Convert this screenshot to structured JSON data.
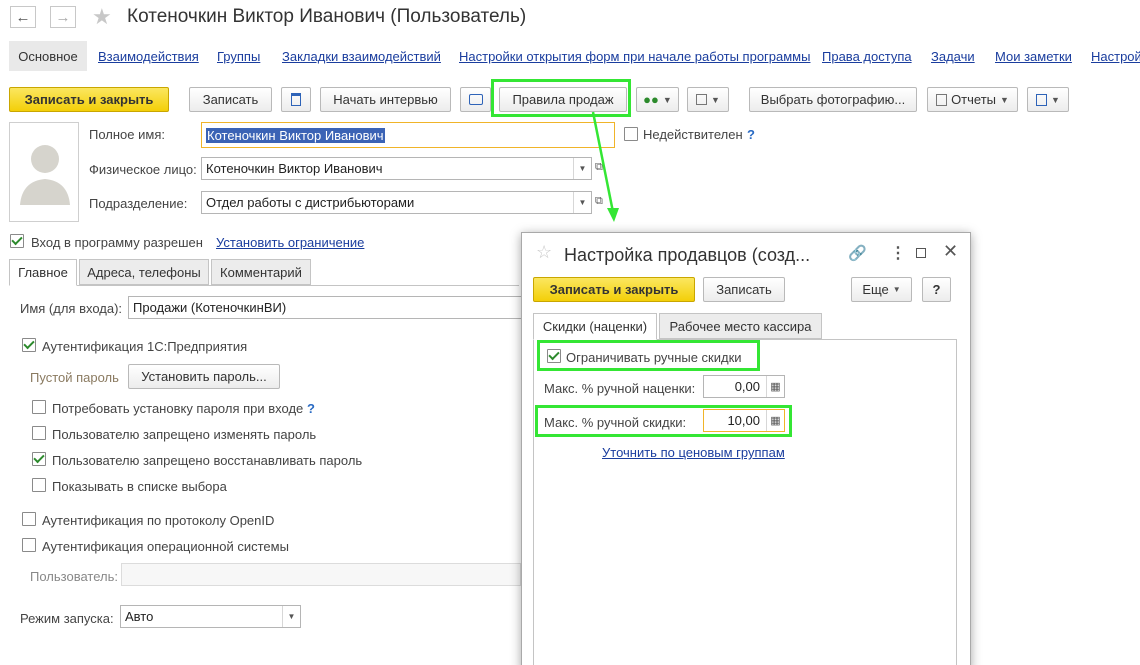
{
  "window": {
    "title": "Котеночкин Виктор Иванович (Пользователь)",
    "back_icon": "arrow-left-icon",
    "forward_icon": "arrow-right-icon",
    "star_icon": "star-icon"
  },
  "nav_tabs": [
    "Основное",
    "Взаимодействия",
    "Группы",
    "Закладки взаимодействий",
    "Настройки открытия форм при начале работы программы",
    "Права доступа",
    "Задачи",
    "Мои заметки",
    "Настрой"
  ],
  "toolbar": {
    "save_close": "Записать и закрыть",
    "save": "Записать",
    "interview": "Начать интервью",
    "sales_rules": "Правила продаж",
    "choose_photo": "Выбрать фотографию...",
    "reports": "Отчеты"
  },
  "form": {
    "full_name_label": "Полное имя:",
    "full_name_value": "Котеночкин Виктор Иванович",
    "inactive_label": "Недействителен",
    "help": "?",
    "person_label": "Физическое лицо:",
    "person_value": "Котеночкин Виктор Иванович",
    "department_label": "Подразделение:",
    "department_value": "Отдел работы с дистрибьюторами",
    "login_allowed_label": "Вход в программу разрешен",
    "login_allowed_checked": true,
    "set_restriction_link": "Установить ограничение"
  },
  "inner_tabs": [
    "Главное",
    "Адреса, телефоны",
    "Комментарий"
  ],
  "main_tab": {
    "login_name_label": "Имя (для входа):",
    "login_name_value": "Продажи (КотеночкинВИ)",
    "auth_1c_label": "Аутентификация 1С:Предприятия",
    "auth_1c_checked": true,
    "empty_password_label": "Пустой пароль",
    "set_password_button": "Установить пароль...",
    "options": [
      {
        "label": "Потребовать установку пароля при входе",
        "checked": false,
        "help": "?"
      },
      {
        "label": "Пользователю запрещено изменять пароль",
        "checked": false
      },
      {
        "label": "Пользователю запрещено восстанавливать пароль",
        "checked": true
      },
      {
        "label": "Показывать в списке выбора",
        "checked": false
      }
    ],
    "auth_openid_label": "Аутентификация по протоколу OpenID",
    "auth_openid_checked": false,
    "auth_os_label": "Аутентификация операционной системы",
    "auth_os_checked": false,
    "os_user_label": "Пользователь:",
    "launch_mode_label": "Режим запуска:",
    "launch_mode_value": "Авто"
  },
  "dialog": {
    "title": "Настройка продавцов (созд...",
    "save_close": "Записать и закрыть",
    "save": "Записать",
    "more": "Еще",
    "help": "?",
    "tabs": [
      "Скидки (наценки)",
      "Рабочее место кассира"
    ],
    "limit_manual_discounts_label": "Ограничивать ручные скидки",
    "limit_manual_discounts_checked": true,
    "max_markup_label": "Макс. % ручной наценки:",
    "max_markup_value": "0,00",
    "max_discount_label": "Макс. % ручной скидки:",
    "max_discount_value": "10,00",
    "price_groups_link": "Уточнить по ценовым группам"
  },
  "colors": {
    "accent_yellow": "#f3cf08",
    "highlight_green": "#34e634",
    "link_blue": "#1a3d9e"
  }
}
